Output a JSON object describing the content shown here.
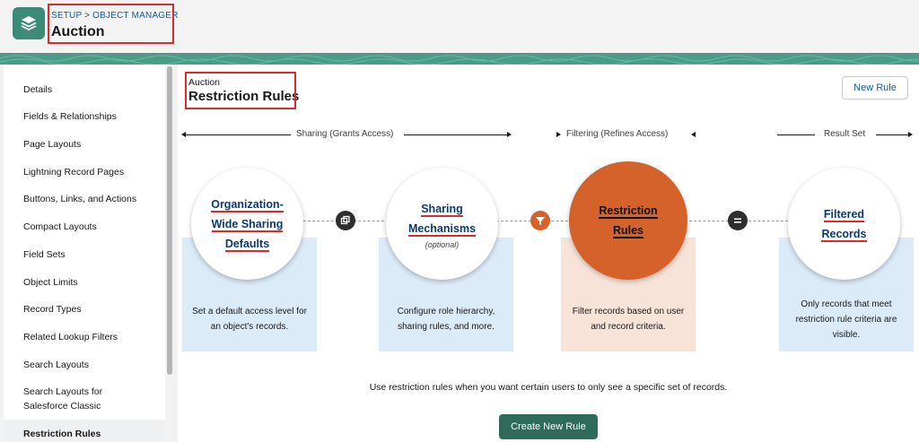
{
  "header": {
    "breadcrumb_setup": "SETUP",
    "breadcrumb_sep": " > ",
    "breadcrumb_object_manager": "OBJECT MANAGER",
    "object_title": "Auction",
    "icon": "layers-icon"
  },
  "sidebar": {
    "items": [
      {
        "label": "Details"
      },
      {
        "label": "Fields & Relationships"
      },
      {
        "label": "Page Layouts"
      },
      {
        "label": "Lightning Record Pages"
      },
      {
        "label": "Buttons, Links, and Actions"
      },
      {
        "label": "Compact Layouts"
      },
      {
        "label": "Field Sets"
      },
      {
        "label": "Object Limits"
      },
      {
        "label": "Record Types"
      },
      {
        "label": "Related Lookup Filters"
      },
      {
        "label": "Search Layouts"
      },
      {
        "label": "Search Layouts for Salesforce Classic"
      },
      {
        "label": "Restriction Rules",
        "active": true
      }
    ]
  },
  "main": {
    "crumb": "Auction",
    "title": "Restriction Rules",
    "new_rule_label": "New Rule",
    "sections": {
      "sharing": "Sharing (Grants Access)",
      "filtering": "Filtering (Refines Access)",
      "result": "Result Set"
    },
    "steps": [
      {
        "title_lines": [
          "Organization-",
          "Wide Sharing",
          "Defaults"
        ],
        "subtitle": "",
        "description": "Set a default access level for an object's records."
      },
      {
        "title_lines": [
          "Sharing",
          "Mechanisms"
        ],
        "subtitle": "(optional)",
        "description": "Configure role hierarchy, sharing rules, and more."
      },
      {
        "title_lines": [
          "Restriction",
          "Rules"
        ],
        "subtitle": "",
        "description": "Filter records based on user and record criteria."
      },
      {
        "title_lines": [
          "Filtered",
          "Records"
        ],
        "subtitle": "",
        "description": "Only records that meet restriction rule criteria are visible."
      }
    ],
    "connectors": [
      "copy-icon",
      "filter-icon",
      "equals-icon"
    ],
    "footer_text": "Use restriction rules when you want certain users to only see a specific set of records.",
    "create_rule_label": "Create New Rule"
  },
  "colors": {
    "brand": "#3c8a78",
    "highlight": "#e0272b",
    "orange": "#d5622a",
    "card_blue": "#dcebf8",
    "card_orange": "#f7e3d8",
    "button_primary": "#2f6b5b"
  }
}
